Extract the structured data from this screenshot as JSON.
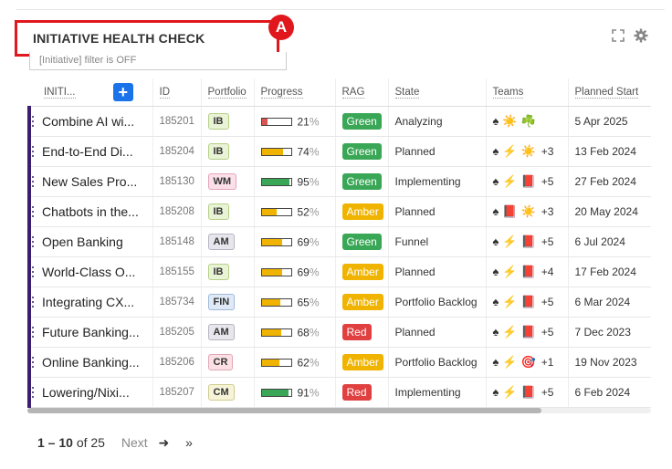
{
  "header": {
    "title": "INITIATIVE HEALTH CHECK",
    "annotation_label": "A",
    "filter_text": "[Initiative] filter is OFF"
  },
  "table": {
    "columns": [
      "INITI...",
      "ID",
      "Portfolio",
      "Progress",
      "RAG",
      "State",
      "Teams",
      "Planned Start"
    ],
    "add_button_label": "+",
    "rows": [
      {
        "name": "Combine AI wi...",
        "id": "185201",
        "portfolio": "IB",
        "progress": 21,
        "progress_text": "21",
        "rag": "Green",
        "state": "Analyzing",
        "teams": [
          "♠",
          "☀️",
          "☘️"
        ],
        "more": "",
        "start": "5 Apr 2025"
      },
      {
        "name": "End-to-End Di...",
        "id": "185204",
        "portfolio": "IB",
        "progress": 74,
        "progress_text": "74",
        "rag": "Green",
        "state": "Planned",
        "teams": [
          "♠",
          "⚡",
          "☀️"
        ],
        "more": "+3",
        "start": "13 Feb 2024"
      },
      {
        "name": "New Sales Pro...",
        "id": "185130",
        "portfolio": "WM",
        "progress": 95,
        "progress_text": "95",
        "rag": "Green",
        "state": "Implementing",
        "teams": [
          "♠",
          "⚡",
          "📕"
        ],
        "more": "+5",
        "start": "27 Feb 2024"
      },
      {
        "name": "Chatbots in the...",
        "id": "185208",
        "portfolio": "IB",
        "progress": 52,
        "progress_text": "52",
        "rag": "Amber",
        "state": "Planned",
        "teams": [
          "♠",
          "📕",
          "☀️"
        ],
        "more": "+3",
        "start": "20 May 2024"
      },
      {
        "name": "Open Banking",
        "id": "185148",
        "portfolio": "AM",
        "progress": 69,
        "progress_text": "69",
        "rag": "Green",
        "state": "Funnel",
        "teams": [
          "♠",
          "⚡",
          "📕"
        ],
        "more": "+5",
        "start": "6 Jul 2024"
      },
      {
        "name": "World-Class O...",
        "id": "185155",
        "portfolio": "IB",
        "progress": 69,
        "progress_text": "69",
        "rag": "Amber",
        "state": "Planned",
        "teams": [
          "♠",
          "⚡",
          "📕"
        ],
        "more": "+4",
        "start": "17 Feb 2024"
      },
      {
        "name": "Integrating CX...",
        "id": "185734",
        "portfolio": "FIN",
        "progress": 65,
        "progress_text": "65",
        "rag": "Amber",
        "state": "Portfolio Backlog",
        "teams": [
          "♠",
          "⚡",
          "📕"
        ],
        "more": "+5",
        "start": "6 Mar 2024"
      },
      {
        "name": "Future Banking...",
        "id": "185205",
        "portfolio": "AM",
        "progress": 68,
        "progress_text": "68",
        "rag": "Red",
        "state": "Planned",
        "teams": [
          "♠",
          "⚡",
          "📕"
        ],
        "more": "+5",
        "start": "7 Dec 2023"
      },
      {
        "name": "Online Banking...",
        "id": "185206",
        "portfolio": "CR",
        "progress": 62,
        "progress_text": "62",
        "rag": "Amber",
        "state": "Portfolio Backlog",
        "teams": [
          "♠",
          "⚡",
          "🎯"
        ],
        "more": "+1",
        "start": "19 Nov 2023"
      },
      {
        "name": "Lowering/Nixi...",
        "id": "185207",
        "portfolio": "CM",
        "progress": 91,
        "progress_text": "91",
        "rag": "Red",
        "state": "Implementing",
        "teams": [
          "♠",
          "⚡",
          "📕"
        ],
        "more": "+5",
        "start": "6 Feb 2024"
      }
    ]
  },
  "portfolio_colors": {
    "IB": {
      "bg": "#e9f3d6",
      "border": "#b6cf86"
    },
    "WM": {
      "bg": "#fbe0ea",
      "border": "#e5a2bb"
    },
    "AM": {
      "bg": "#e6e6ec",
      "border": "#b5b5c4"
    },
    "FIN": {
      "bg": "#dfeaf6",
      "border": "#9fb9da"
    },
    "CR": {
      "bg": "#fbe0e6",
      "border": "#e3a7b4"
    },
    "CM": {
      "bg": "#f6f4d8",
      "border": "#cfcb8f"
    }
  },
  "rag_colors": {
    "Green": "#3aa757",
    "Amber": "#f0b400",
    "Red": "#e04040"
  },
  "progress_colors": {
    "low": "#d9534f",
    "mid": "#f0b400",
    "high": "#3aa757"
  },
  "pagination": {
    "range": "1 – 10",
    "of_text": "of 25",
    "next_label": "Next",
    "next_arrow": "➜",
    "last_arrow": "»"
  }
}
